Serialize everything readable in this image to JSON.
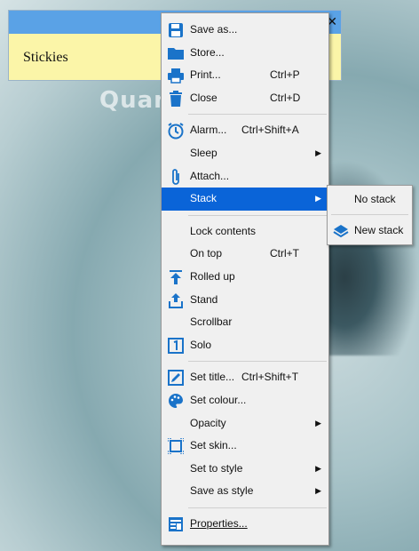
{
  "note": {
    "title": "Stickies"
  },
  "watermark": "Quantrimang",
  "menu": {
    "items": [
      {
        "label": "Save as...",
        "shortcut": "",
        "icon": "save-icon",
        "submenu": false
      },
      {
        "label": "Store...",
        "shortcut": "",
        "icon": "folder-icon",
        "submenu": false
      },
      {
        "label": "Print...",
        "shortcut": "Ctrl+P",
        "icon": "printer-icon",
        "submenu": false
      },
      {
        "label": "Close",
        "shortcut": "Ctrl+D",
        "icon": "trash-icon",
        "submenu": false
      },
      {
        "label": "Alarm...",
        "shortcut": "Ctrl+Shift+A",
        "icon": "alarm-icon",
        "submenu": false
      },
      {
        "label": "Sleep",
        "shortcut": "",
        "icon": "",
        "submenu": true
      },
      {
        "label": "Attach...",
        "shortcut": "",
        "icon": "paperclip-icon",
        "submenu": false
      },
      {
        "label": "Stack",
        "shortcut": "",
        "icon": "",
        "submenu": true,
        "selected": true
      },
      {
        "label": "Lock contents",
        "shortcut": "",
        "icon": "",
        "submenu": false
      },
      {
        "label": "On top",
        "shortcut": "Ctrl+T",
        "icon": "",
        "submenu": false
      },
      {
        "label": "Rolled up",
        "shortcut": "",
        "icon": "rolled-up-icon",
        "submenu": false
      },
      {
        "label": "Stand",
        "shortcut": "",
        "icon": "stand-icon",
        "submenu": false
      },
      {
        "label": "Scrollbar",
        "shortcut": "",
        "icon": "",
        "submenu": false
      },
      {
        "label": "Solo",
        "shortcut": "",
        "icon": "solo-icon",
        "submenu": false
      },
      {
        "label": "Set title...",
        "shortcut": "Ctrl+Shift+T",
        "icon": "edit-title-icon",
        "submenu": false
      },
      {
        "label": "Set colour...",
        "shortcut": "",
        "icon": "palette-icon",
        "submenu": false
      },
      {
        "label": "Opacity",
        "shortcut": "",
        "icon": "",
        "submenu": true
      },
      {
        "label": "Set skin...",
        "shortcut": "",
        "icon": "skin-icon",
        "submenu": false
      },
      {
        "label": "Set to style",
        "shortcut": "",
        "icon": "",
        "submenu": true
      },
      {
        "label": "Save as style",
        "shortcut": "",
        "icon": "",
        "submenu": true
      },
      {
        "label": "Properties...",
        "shortcut": "",
        "icon": "properties-icon",
        "submenu": false
      }
    ]
  },
  "submenu": {
    "items": [
      {
        "label": "No stack",
        "icon": ""
      },
      {
        "label": "New stack",
        "icon": "layers-icon"
      }
    ]
  },
  "colors": {
    "selection": "#0a64d8",
    "icon": "#1a73c9",
    "note_bg": "#fbf5a8",
    "note_bar": "#5aa2e6"
  }
}
